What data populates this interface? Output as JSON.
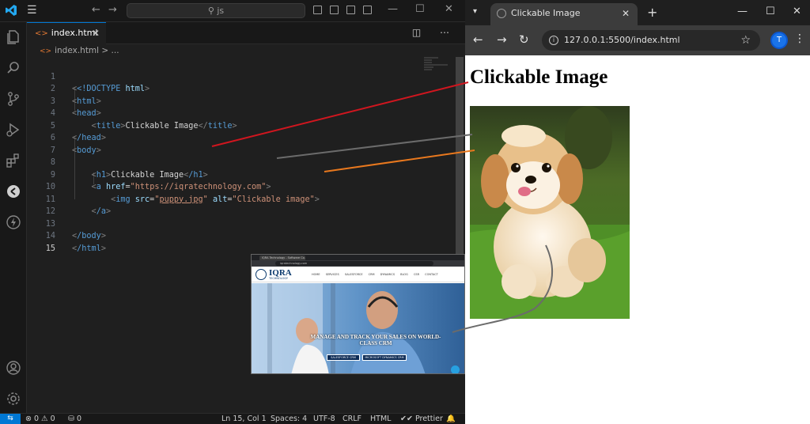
{
  "vscode": {
    "search_text": "js",
    "tab": {
      "filename": "index.html",
      "close": "✕"
    },
    "breadcrumb": {
      "file": "index.html",
      "sep": "> ..."
    },
    "code": [
      {
        "n": "1"
      },
      {
        "n": "2"
      },
      {
        "n": "3"
      },
      {
        "n": "4"
      },
      {
        "n": "5"
      },
      {
        "n": "6"
      },
      {
        "n": "7"
      },
      {
        "n": "8"
      },
      {
        "n": "9"
      },
      {
        "n": "10"
      },
      {
        "n": "11"
      },
      {
        "n": "12"
      },
      {
        "n": "13"
      },
      {
        "n": "14"
      },
      {
        "n": "15"
      }
    ],
    "tokens": {
      "doctype": "<!DOCTYPE",
      "doctype_val": "html",
      "html_open": "html",
      "head_open": "head",
      "title_tag": "title",
      "title_text": "Clickable Image",
      "head_close": "/head",
      "body_open": "body",
      "h1_tag": "h1",
      "h1_text": "Clickable Image",
      "h1_close": "/h1",
      "a_tag": "a",
      "href_attr": "href",
      "href_val": "\"https://iqratechnology.com\"",
      "img_tag": "img",
      "src_attr": "src",
      "src_q1": "\"",
      "src_val": "puppy.jpg",
      "src_q2": "\"",
      "alt_attr": "alt",
      "alt_val": "\"Clickable image\"",
      "a_close": "/a",
      "body_close": "/body",
      "html_close": "/html"
    },
    "status": {
      "errors": "0",
      "warnings": "0",
      "ports": "0",
      "position": "Ln 15, Col 1",
      "spaces": "Spaces: 4",
      "encoding": "UTF-8",
      "eol": "CRLF",
      "language": "HTML",
      "formatter": "Prettier"
    }
  },
  "browser": {
    "tab_title": "Clickable Image",
    "url": "127.0.0.1:5500/index.html",
    "avatar_letter": "T",
    "page": {
      "heading": "Clickable Image",
      "image_alt": "Clickable image"
    }
  },
  "linked_site": {
    "tab_title": "IQRA Technology - Software Co...",
    "url": "iqratechnology.com",
    "logo": "IQRA",
    "logo_sub": "TECHNOLOGY",
    "menu": "HOME SERVICES SALESFORCE CRM DYNAMICS BLOG CSR CONTACT",
    "headline": "MANAGE AND TRACK YOUR SALES ON WORLD-CLASS CRM",
    "buttons": [
      "SALESFORCE CRM",
      "MICROSOFT DYNAMICS CRM"
    ]
  },
  "colors": {
    "annotation_h1": "#d0161f",
    "annotation_link": "#6b6b6b",
    "annotation_img": "#e8781e",
    "vscode_accent": "#0078d4"
  }
}
